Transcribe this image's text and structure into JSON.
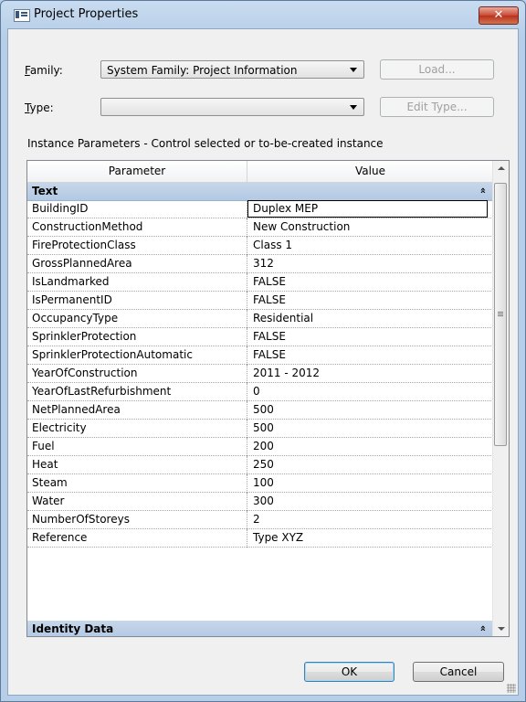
{
  "window": {
    "title": "Project Properties",
    "close_glyph": "✕"
  },
  "family": {
    "label_hotkey": "F",
    "label_rest": "amily:",
    "value": "System Family: Project Information",
    "load_label": "Load..."
  },
  "type": {
    "label_hotkey": "T",
    "label_rest": "ype:",
    "value": "",
    "edit_type_label": "Edit Type..."
  },
  "instance_description": "Instance Parameters - Control selected or to-be-created instance",
  "grid": {
    "header_parameter": "Parameter",
    "header_value": "Value",
    "groups": [
      {
        "name": "Text",
        "chevron": "»"
      },
      {
        "name": "Identity Data",
        "chevron": "»"
      }
    ],
    "rows": [
      {
        "parameter": "BuildingID",
        "value": "Duplex MEP"
      },
      {
        "parameter": "ConstructionMethod",
        "value": "New Construction"
      },
      {
        "parameter": "FireProtectionClass",
        "value": "Class 1"
      },
      {
        "parameter": "GrossPlannedArea",
        "value": "312"
      },
      {
        "parameter": "IsLandmarked",
        "value": "FALSE"
      },
      {
        "parameter": "IsPermanentID",
        "value": "FALSE"
      },
      {
        "parameter": "OccupancyType",
        "value": "Residential"
      },
      {
        "parameter": "SprinklerProtection",
        "value": "FALSE"
      },
      {
        "parameter": "SprinklerProtectionAutomatic",
        "value": "FALSE"
      },
      {
        "parameter": "YearOfConstruction",
        "value": "2011 - 2012"
      },
      {
        "parameter": "YearOfLastRefurbishment",
        "value": "0"
      },
      {
        "parameter": "NetPlannedArea",
        "value": "500"
      },
      {
        "parameter": "Electricity",
        "value": "500"
      },
      {
        "parameter": "Fuel",
        "value": "200"
      },
      {
        "parameter": "Heat",
        "value": "250"
      },
      {
        "parameter": "Steam",
        "value": "100"
      },
      {
        "parameter": "Water",
        "value": "300"
      },
      {
        "parameter": "NumberOfStoreys",
        "value": "2"
      },
      {
        "parameter": "Reference",
        "value": "Type XYZ"
      }
    ]
  },
  "buttons": {
    "ok": "OK",
    "cancel": "Cancel"
  }
}
